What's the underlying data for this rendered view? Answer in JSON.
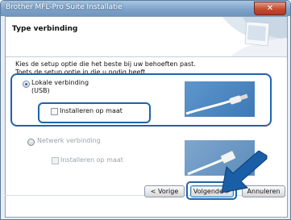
{
  "window": {
    "title": "Brother MFL-Pro Suite Installatie",
    "close_label": "✕"
  },
  "header": {
    "title": "Type verbinding"
  },
  "intro": {
    "line1": "Kies de setup optie die het beste bij uw behoeften past.",
    "line2": "Toets de setup optie in die u nodig heeft."
  },
  "options": {
    "local": {
      "label": "Lokale verbinding",
      "sublabel": "(USB)",
      "checkbox_label": "Installeren op maat",
      "selected": true
    },
    "network": {
      "label": "Netwerk verbinding",
      "checkbox_label": "Installeren op maat",
      "selected": false
    }
  },
  "buttons": {
    "back": "< Vorige",
    "next": "Volgende >",
    "cancel": "Annuleren"
  },
  "colors": {
    "highlight": "#1e63ad",
    "arrow": "#1a5ea8",
    "image_bg": "#4a85c0"
  }
}
